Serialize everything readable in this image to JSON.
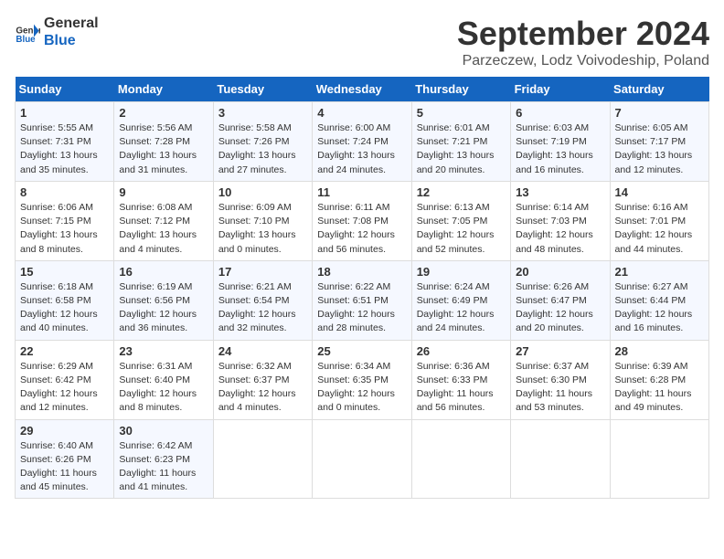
{
  "logo": {
    "text_general": "General",
    "text_blue": "Blue"
  },
  "title": "September 2024",
  "subtitle": "Parzeczew, Lodz Voivodeship, Poland",
  "days_of_week": [
    "Sunday",
    "Monday",
    "Tuesday",
    "Wednesday",
    "Thursday",
    "Friday",
    "Saturday"
  ],
  "weeks": [
    [
      {
        "day": "1",
        "sunrise": "Sunrise: 5:55 AM",
        "sunset": "Sunset: 7:31 PM",
        "daylight": "Daylight: 13 hours and 35 minutes."
      },
      {
        "day": "2",
        "sunrise": "Sunrise: 5:56 AM",
        "sunset": "Sunset: 7:28 PM",
        "daylight": "Daylight: 13 hours and 31 minutes."
      },
      {
        "day": "3",
        "sunrise": "Sunrise: 5:58 AM",
        "sunset": "Sunset: 7:26 PM",
        "daylight": "Daylight: 13 hours and 27 minutes."
      },
      {
        "day": "4",
        "sunrise": "Sunrise: 6:00 AM",
        "sunset": "Sunset: 7:24 PM",
        "daylight": "Daylight: 13 hours and 24 minutes."
      },
      {
        "day": "5",
        "sunrise": "Sunrise: 6:01 AM",
        "sunset": "Sunset: 7:21 PM",
        "daylight": "Daylight: 13 hours and 20 minutes."
      },
      {
        "day": "6",
        "sunrise": "Sunrise: 6:03 AM",
        "sunset": "Sunset: 7:19 PM",
        "daylight": "Daylight: 13 hours and 16 minutes."
      },
      {
        "day": "7",
        "sunrise": "Sunrise: 6:05 AM",
        "sunset": "Sunset: 7:17 PM",
        "daylight": "Daylight: 13 hours and 12 minutes."
      }
    ],
    [
      {
        "day": "8",
        "sunrise": "Sunrise: 6:06 AM",
        "sunset": "Sunset: 7:15 PM",
        "daylight": "Daylight: 13 hours and 8 minutes."
      },
      {
        "day": "9",
        "sunrise": "Sunrise: 6:08 AM",
        "sunset": "Sunset: 7:12 PM",
        "daylight": "Daylight: 13 hours and 4 minutes."
      },
      {
        "day": "10",
        "sunrise": "Sunrise: 6:09 AM",
        "sunset": "Sunset: 7:10 PM",
        "daylight": "Daylight: 13 hours and 0 minutes."
      },
      {
        "day": "11",
        "sunrise": "Sunrise: 6:11 AM",
        "sunset": "Sunset: 7:08 PM",
        "daylight": "Daylight: 12 hours and 56 minutes."
      },
      {
        "day": "12",
        "sunrise": "Sunrise: 6:13 AM",
        "sunset": "Sunset: 7:05 PM",
        "daylight": "Daylight: 12 hours and 52 minutes."
      },
      {
        "day": "13",
        "sunrise": "Sunrise: 6:14 AM",
        "sunset": "Sunset: 7:03 PM",
        "daylight": "Daylight: 12 hours and 48 minutes."
      },
      {
        "day": "14",
        "sunrise": "Sunrise: 6:16 AM",
        "sunset": "Sunset: 7:01 PM",
        "daylight": "Daylight: 12 hours and 44 minutes."
      }
    ],
    [
      {
        "day": "15",
        "sunrise": "Sunrise: 6:18 AM",
        "sunset": "Sunset: 6:58 PM",
        "daylight": "Daylight: 12 hours and 40 minutes."
      },
      {
        "day": "16",
        "sunrise": "Sunrise: 6:19 AM",
        "sunset": "Sunset: 6:56 PM",
        "daylight": "Daylight: 12 hours and 36 minutes."
      },
      {
        "day": "17",
        "sunrise": "Sunrise: 6:21 AM",
        "sunset": "Sunset: 6:54 PM",
        "daylight": "Daylight: 12 hours and 32 minutes."
      },
      {
        "day": "18",
        "sunrise": "Sunrise: 6:22 AM",
        "sunset": "Sunset: 6:51 PM",
        "daylight": "Daylight: 12 hours and 28 minutes."
      },
      {
        "day": "19",
        "sunrise": "Sunrise: 6:24 AM",
        "sunset": "Sunset: 6:49 PM",
        "daylight": "Daylight: 12 hours and 24 minutes."
      },
      {
        "day": "20",
        "sunrise": "Sunrise: 6:26 AM",
        "sunset": "Sunset: 6:47 PM",
        "daylight": "Daylight: 12 hours and 20 minutes."
      },
      {
        "day": "21",
        "sunrise": "Sunrise: 6:27 AM",
        "sunset": "Sunset: 6:44 PM",
        "daylight": "Daylight: 12 hours and 16 minutes."
      }
    ],
    [
      {
        "day": "22",
        "sunrise": "Sunrise: 6:29 AM",
        "sunset": "Sunset: 6:42 PM",
        "daylight": "Daylight: 12 hours and 12 minutes."
      },
      {
        "day": "23",
        "sunrise": "Sunrise: 6:31 AM",
        "sunset": "Sunset: 6:40 PM",
        "daylight": "Daylight: 12 hours and 8 minutes."
      },
      {
        "day": "24",
        "sunrise": "Sunrise: 6:32 AM",
        "sunset": "Sunset: 6:37 PM",
        "daylight": "Daylight: 12 hours and 4 minutes."
      },
      {
        "day": "25",
        "sunrise": "Sunrise: 6:34 AM",
        "sunset": "Sunset: 6:35 PM",
        "daylight": "Daylight: 12 hours and 0 minutes."
      },
      {
        "day": "26",
        "sunrise": "Sunrise: 6:36 AM",
        "sunset": "Sunset: 6:33 PM",
        "daylight": "Daylight: 11 hours and 56 minutes."
      },
      {
        "day": "27",
        "sunrise": "Sunrise: 6:37 AM",
        "sunset": "Sunset: 6:30 PM",
        "daylight": "Daylight: 11 hours and 53 minutes."
      },
      {
        "day": "28",
        "sunrise": "Sunrise: 6:39 AM",
        "sunset": "Sunset: 6:28 PM",
        "daylight": "Daylight: 11 hours and 49 minutes."
      }
    ],
    [
      {
        "day": "29",
        "sunrise": "Sunrise: 6:40 AM",
        "sunset": "Sunset: 6:26 PM",
        "daylight": "Daylight: 11 hours and 45 minutes."
      },
      {
        "day": "30",
        "sunrise": "Sunrise: 6:42 AM",
        "sunset": "Sunset: 6:23 PM",
        "daylight": "Daylight: 11 hours and 41 minutes."
      },
      null,
      null,
      null,
      null,
      null
    ]
  ]
}
